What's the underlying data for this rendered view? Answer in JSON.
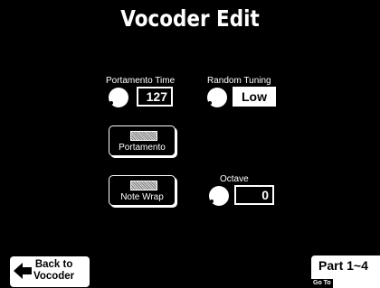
{
  "header": {
    "title": "Vocoder Edit"
  },
  "controls": {
    "portamento_time": {
      "label": "Portamento Time",
      "value": "127"
    },
    "random_tuning": {
      "label": "Random Tuning",
      "value": "Low"
    },
    "portamento_switch": {
      "label": "Portamento"
    },
    "note_wrap_switch": {
      "label": "Note Wrap"
    },
    "octave": {
      "label": "Octave",
      "value": "0"
    }
  },
  "footer": {
    "back_label_line1": "Back to",
    "back_label_line2": "Vocoder",
    "part_label": "Part 1~4",
    "goto_label": "Go To"
  }
}
